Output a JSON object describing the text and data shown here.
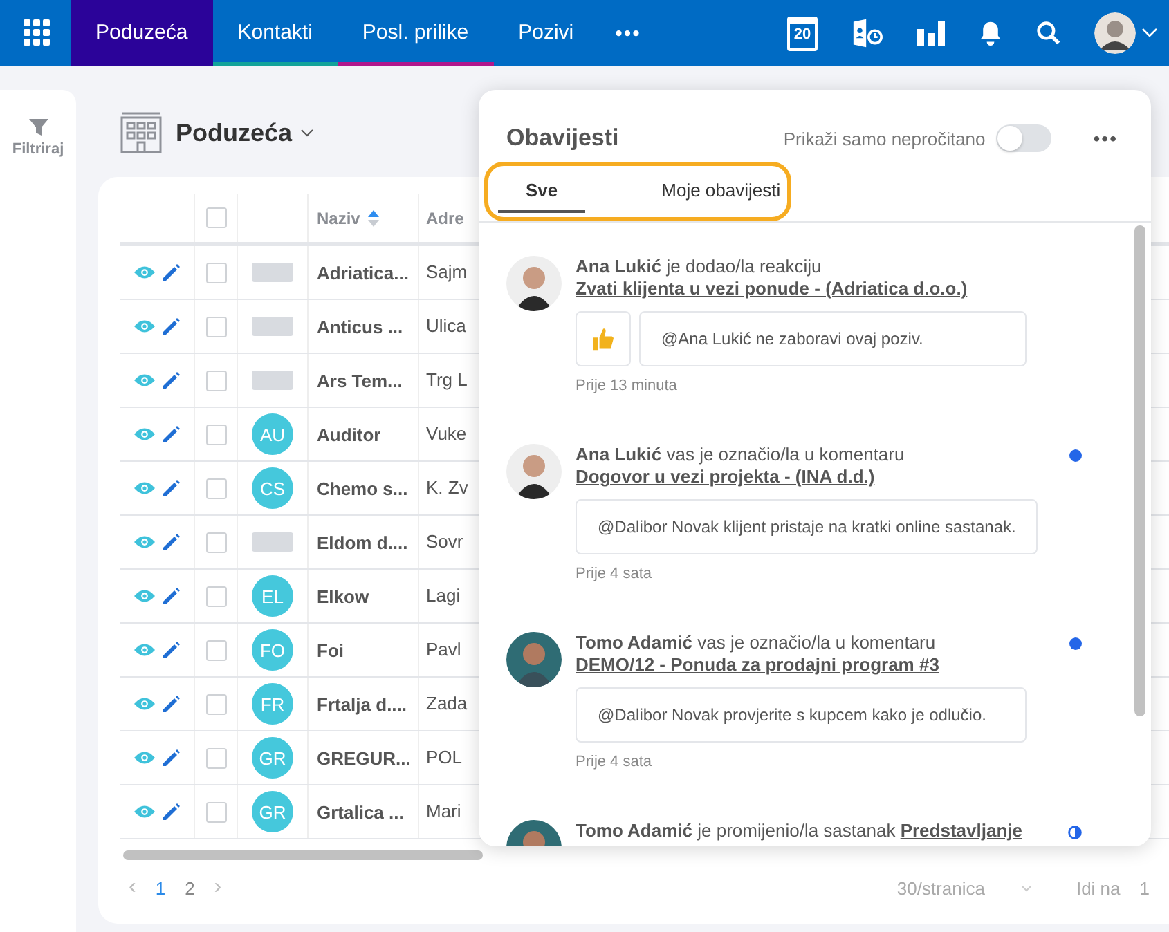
{
  "nav": {
    "tabs": [
      {
        "label": "Poduzeća",
        "selected": true
      },
      {
        "label": "Kontakti",
        "selected": false,
        "color": "#12a39a"
      },
      {
        "label": "Posl. prilike",
        "selected": false,
        "color": "#b0168c"
      },
      {
        "label": "Pozivi",
        "selected": false
      }
    ],
    "more": "•••",
    "calendar_day": "20"
  },
  "sidebar": {
    "filter_label": "Filtriraj"
  },
  "page_title": "Poduzeća",
  "table": {
    "select_all_checked": false,
    "columns": [
      "Naziv",
      "Adre"
    ],
    "rows": [
      {
        "checked": false,
        "logo": {
          "kind": "logo"
        },
        "name": "Adriatica...",
        "address": "Sajm"
      },
      {
        "checked": false,
        "logo": {
          "kind": "logo"
        },
        "name": "Anticus ...",
        "address": "Ulica"
      },
      {
        "checked": false,
        "logo": {
          "kind": "logo"
        },
        "name": "Ars Tem...",
        "address": "Trg L"
      },
      {
        "checked": false,
        "logo": {
          "kind": "initials",
          "initials": "AU"
        },
        "name": "Auditor",
        "address": "Vuke"
      },
      {
        "checked": false,
        "logo": {
          "kind": "initials",
          "initials": "CS"
        },
        "name": "Chemo s...",
        "address": "K. Zv"
      },
      {
        "checked": false,
        "logo": {
          "kind": "logo"
        },
        "name": "Eldom d....",
        "address": "Sovr"
      },
      {
        "checked": false,
        "logo": {
          "kind": "initials",
          "initials": "EL"
        },
        "name": "Elkow",
        "address": "Lagi"
      },
      {
        "checked": false,
        "logo": {
          "kind": "initials",
          "initials": "FO"
        },
        "name": "Foi",
        "address": "Pavl"
      },
      {
        "checked": false,
        "logo": {
          "kind": "initials",
          "initials": "FR"
        },
        "name": "Frtalja d....",
        "address": "Zada"
      },
      {
        "checked": false,
        "logo": {
          "kind": "initials",
          "initials": "GR"
        },
        "name": "GREGUR...",
        "address": "POL"
      },
      {
        "checked": false,
        "logo": {
          "kind": "initials",
          "initials": "GR"
        },
        "name": "Grtalica ...",
        "address": "Mari"
      }
    ]
  },
  "pagination": {
    "prev": "‹",
    "next": "›",
    "pages": [
      {
        "label": "1",
        "selected": true
      },
      {
        "label": "2",
        "selected": false
      }
    ],
    "page_size": "30/stranica",
    "goto_label": "Idi na",
    "goto_value": "1"
  },
  "notifications": {
    "title": "Obavijesti",
    "unread_only": {
      "label": "Prikaži samo nepročitano",
      "on": false
    },
    "more": "•••",
    "tabs": [
      {
        "label": "Sve",
        "selected": true
      },
      {
        "label": "Moje obavijesti",
        "selected": false
      }
    ],
    "items": [
      {
        "actor": "Ana Lukić",
        "action": "je dodao/la reakciju",
        "link": "Zvati klijenta u vezi ponude - (Adriatica d.o.o.)",
        "reaction": true,
        "comment": "@Ana Lukić ne zaboravi ovaj poziv.",
        "time": "Prije 13 minuta",
        "unread": false
      },
      {
        "actor": "Ana Lukić",
        "action": "vas je označio/la u komentaru",
        "link": "Dogovor u vezi projekta - (INA d.d.)",
        "reaction": false,
        "comment": "@Dalibor Novak klijent pristaje na kratki online sastanak.",
        "time": "Prije 4 sata",
        "unread": true
      },
      {
        "actor": "Tomo Adamić",
        "action": "vas je označio/la u komentaru",
        "link": "DEMO/12 - Ponuda za prodajni program #3",
        "reaction": false,
        "comment": "@Dalibor Novak provjerite s kupcem kako je odlučio.",
        "time": "Prije 4 sata",
        "unread": true
      },
      {
        "actor": "Tomo Adamić",
        "action": "je promijenio/la sastanak",
        "link": "Predstavljanje",
        "unread": true,
        "half_read": true
      }
    ]
  }
}
